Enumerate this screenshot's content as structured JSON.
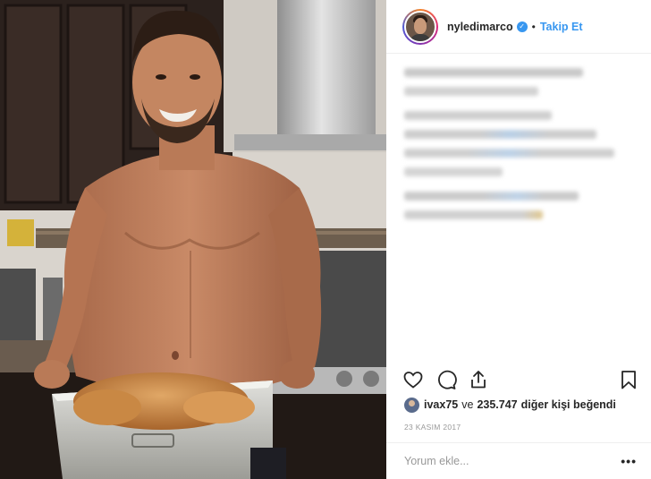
{
  "post": {
    "username": "nyledimarco",
    "verified_icon": "verified-badge-icon",
    "follow_label": "Takip Et",
    "separator": "•"
  },
  "likes": {
    "user": "ivax75",
    "connector": "ve",
    "count": "235.747",
    "suffix": "diğer kişi beğendi"
  },
  "date": "23 KASIM 2017",
  "comment": {
    "placeholder": "Yorum ekle...",
    "more_label": "•••"
  },
  "icons": {
    "like": "heart-icon",
    "comment": "comment-icon",
    "share": "share-icon",
    "save": "bookmark-icon"
  },
  "colors": {
    "accent": "#3897f0",
    "text": "#262626",
    "muted": "#999999"
  }
}
